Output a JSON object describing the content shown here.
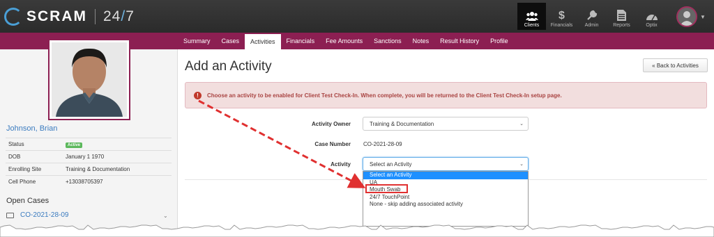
{
  "brand": {
    "name": "SCRAM",
    "tagline_a": "24",
    "tagline_slash": "/",
    "tagline_b": "7"
  },
  "topnav": [
    {
      "label": "Clients",
      "icon": "clients-icon",
      "active": true
    },
    {
      "label": "Financials",
      "icon": "dollar-icon",
      "active": false
    },
    {
      "label": "Admin",
      "icon": "wrench-icon",
      "active": false
    },
    {
      "label": "Reports",
      "icon": "document-icon",
      "active": false
    },
    {
      "label": "Optix",
      "icon": "gauge-icon",
      "active": false
    }
  ],
  "tabs": [
    "Summary",
    "Cases",
    "Activities",
    "Financials",
    "Fee Amounts",
    "Sanctions",
    "Notes",
    "Result History",
    "Profile"
  ],
  "active_tab": "Activities",
  "client": {
    "name": "Johnson, Brian",
    "rows": [
      {
        "label": "Status",
        "value": "Active"
      },
      {
        "label": "DOB",
        "value": "January 1 1970"
      },
      {
        "label": "Enrolling Site",
        "value": "Training & Documentation"
      },
      {
        "label": "Cell Phone",
        "value": "+13038705397"
      }
    ]
  },
  "open_cases": {
    "heading": "Open Cases",
    "case_number": "CO-2021-28-09"
  },
  "page": {
    "title": "Add an Activity",
    "back_button": "« Back to Activities",
    "alert": "Choose an activity to be enabled for Client Test Check-In. When complete, you will be returned to the Client Test Check-In setup page."
  },
  "form": {
    "owner_label": "Activity Owner",
    "owner_value": "Training & Documentation",
    "case_label": "Case Number",
    "case_value": "CO-2021-28-09",
    "activity_label": "Activity",
    "activity_value": "Select an Activity",
    "options": [
      "Select an Activity",
      "UA",
      "Mouth Swab",
      "24/7 TouchPoint",
      "None - skip adding associated activity"
    ],
    "selected_option": "Select an Activity",
    "highlighted_option": "Mouth Swab"
  },
  "colors": {
    "brand_maroon": "#8c1f52",
    "link_blue": "#3a7bbf",
    "annotation_red": "#e03030"
  }
}
